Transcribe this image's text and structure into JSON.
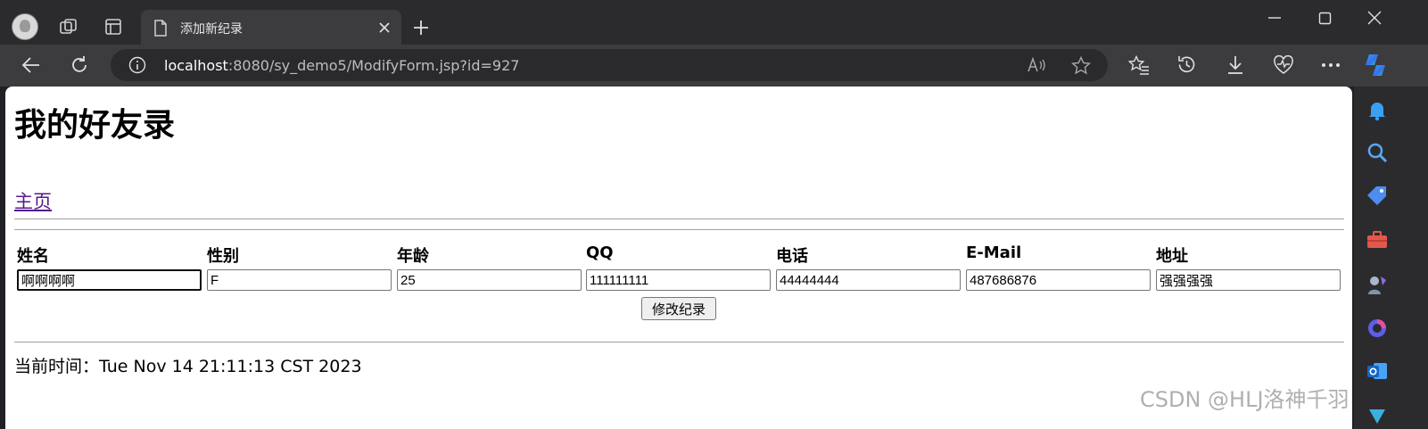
{
  "browser": {
    "tab_title": "添加新纪录",
    "url_host": "localhost",
    "url_rest": ":8080/sy_demo5/ModifyForm.jsp?id=927"
  },
  "page": {
    "heading": "我的好友录",
    "home_link": "主页",
    "columns": [
      "姓名",
      "性别",
      "年龄",
      "QQ",
      "电话",
      "E-Mail",
      "地址"
    ],
    "fields": {
      "name": "啊啊啊啊",
      "gender": "F",
      "age": "25",
      "qq": "111111111",
      "phone": "44444444",
      "email": "487686876",
      "address": "强强强强"
    },
    "submit_label": "修改纪录",
    "current_time": "当前时间：Tue Nov 14 21:11:13 CST 2023"
  },
  "watermark": "CSDN @HLJ洛神千羽",
  "colors": {
    "chrome_dark": "#2b2b2e",
    "chrome_mid": "#3c3c3f",
    "visited_link": "#551a8b"
  },
  "icons": [
    "profile-avatar",
    "workspaces-icon",
    "tab-actions-icon",
    "page-icon",
    "close-icon",
    "new-tab-icon",
    "back-icon",
    "refresh-icon",
    "info-icon",
    "read-aloud-icon",
    "favorite-icon",
    "favorites-icon",
    "history-icon",
    "download-icon",
    "health-icon",
    "more-icon",
    "copilot-icon"
  ]
}
